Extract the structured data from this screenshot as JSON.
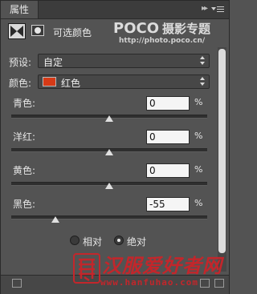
{
  "panel": {
    "tab_label": "属性",
    "collapse_glyph": "▸▸",
    "header_title": "可选颜色",
    "watermark_brand": "POCO",
    "watermark_cn": "摄影专题",
    "watermark_url": "http://photo.poco.cn/"
  },
  "preset": {
    "label": "预设:",
    "value": "自定"
  },
  "colors": {
    "label": "颜色:",
    "value": "红色",
    "swatch": "#d63a17"
  },
  "sliders": [
    {
      "label": "青色:",
      "value": "0",
      "unit": "%",
      "level": 0.5
    },
    {
      "label": "洋红:",
      "value": "0",
      "unit": "%",
      "level": 0.5
    },
    {
      "label": "黄色:",
      "value": "0",
      "unit": "%",
      "level": 0.5
    },
    {
      "label": "黑色:",
      "value": "-55",
      "unit": "%",
      "level": 0.225
    }
  ],
  "method": {
    "relative_label": "相对",
    "absolute_label": "绝对",
    "selected": "absolute"
  },
  "footer_watermark": {
    "text": "汉服爱好者网",
    "url": "www.hanfuhao.com"
  },
  "accent_colors": {
    "swatch_red": "#d63a17",
    "watermark_red": "#c3262b"
  }
}
